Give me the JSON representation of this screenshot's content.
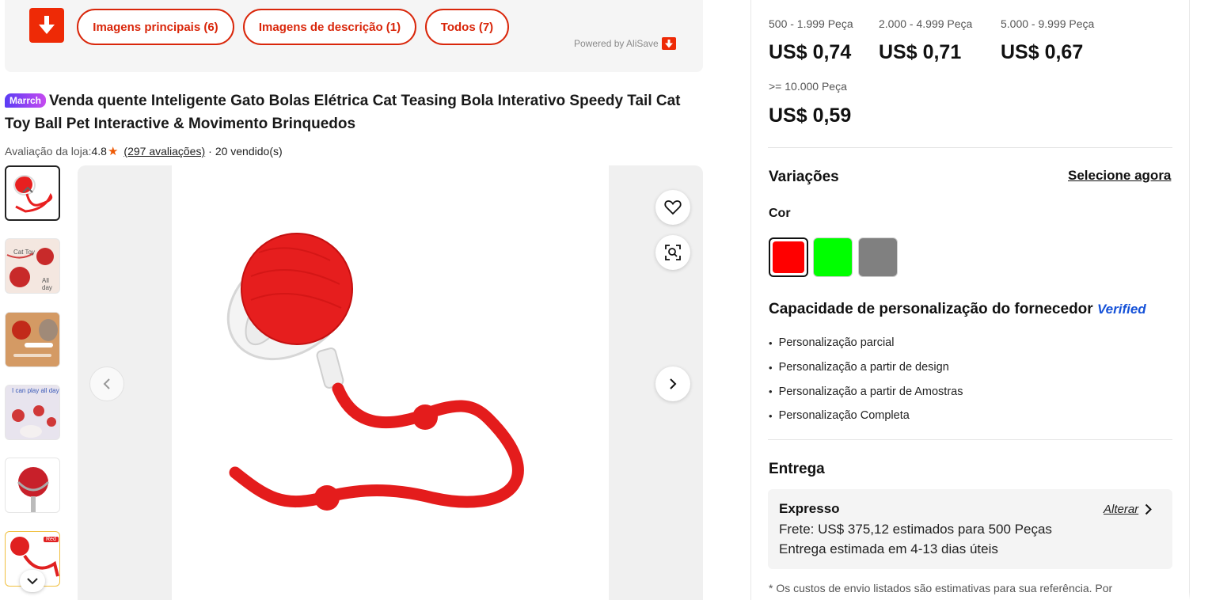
{
  "toolbar": {
    "tabs": [
      {
        "label": "Imagens principais (6)"
      },
      {
        "label": "Imagens de descrição (1)"
      },
      {
        "label": "Todos (7)"
      }
    ],
    "powered_by": "Powered by AliSave"
  },
  "product": {
    "badge": "Marrch",
    "title": "Venda quente Inteligente Gato Bolas Elétrica Cat Teasing Bola Interativo Speedy Tail Cat Toy Ball Pet Interactive & Movimento Brinquedos",
    "rating_label": "Avaliação da loja:",
    "rating_value": "4.8",
    "reviews": "(297 avaliações)",
    "separator": "·",
    "sold": "20 vendido(s)"
  },
  "thumbnails": [
    {
      "icon": "product-thumb-1",
      "caption": ""
    },
    {
      "icon": "product-thumb-2",
      "caption": "Cat Toy"
    },
    {
      "icon": "product-thumb-3",
      "caption": ""
    },
    {
      "icon": "product-thumb-4",
      "caption": "I can play all day"
    },
    {
      "icon": "product-thumb-5",
      "caption": ""
    },
    {
      "icon": "product-thumb-6",
      "caption": "Red"
    }
  ],
  "thumb_caption_extra": "All day",
  "thumb_red_tag": "Red",
  "pricing": {
    "tiers": [
      {
        "qty": "500 - 1.999 Peça",
        "price": "US$ 0,74"
      },
      {
        "qty": "2.000 - 4.999 Peça",
        "price": "US$ 0,71"
      },
      {
        "qty": "5.000 - 9.999 Peça",
        "price": "US$ 0,67"
      },
      {
        "qty": ">= 10.000 Peça",
        "price": "US$ 0,59"
      }
    ]
  },
  "variations": {
    "title": "Variações",
    "select_link": "Selecione agora",
    "color_label": "Cor",
    "colors": [
      "#ff0000",
      "#00ff00",
      "#808080"
    ]
  },
  "customization": {
    "title": "Capacidade de personalização do fornecedor",
    "verified": "Verified",
    "items": [
      "Personalização parcial",
      "Personalização a partir de design",
      "Personalização a partir de Amostras",
      "Personalização Completa"
    ]
  },
  "delivery": {
    "title": "Entrega",
    "method": "Expresso",
    "change": "Alterar",
    "freight": "Frete: US$ 375,12 estimados para 500 Peças",
    "eta": "Entrega estimada em 4-13 dias úteis",
    "note": "* Os custos de envio listados são estimativas para sua referência. Por"
  },
  "colors": {
    "accent": "#d9260a",
    "download_red": "#ee2a06",
    "star": "#ee5a06",
    "verified_blue": "#1652d8"
  }
}
